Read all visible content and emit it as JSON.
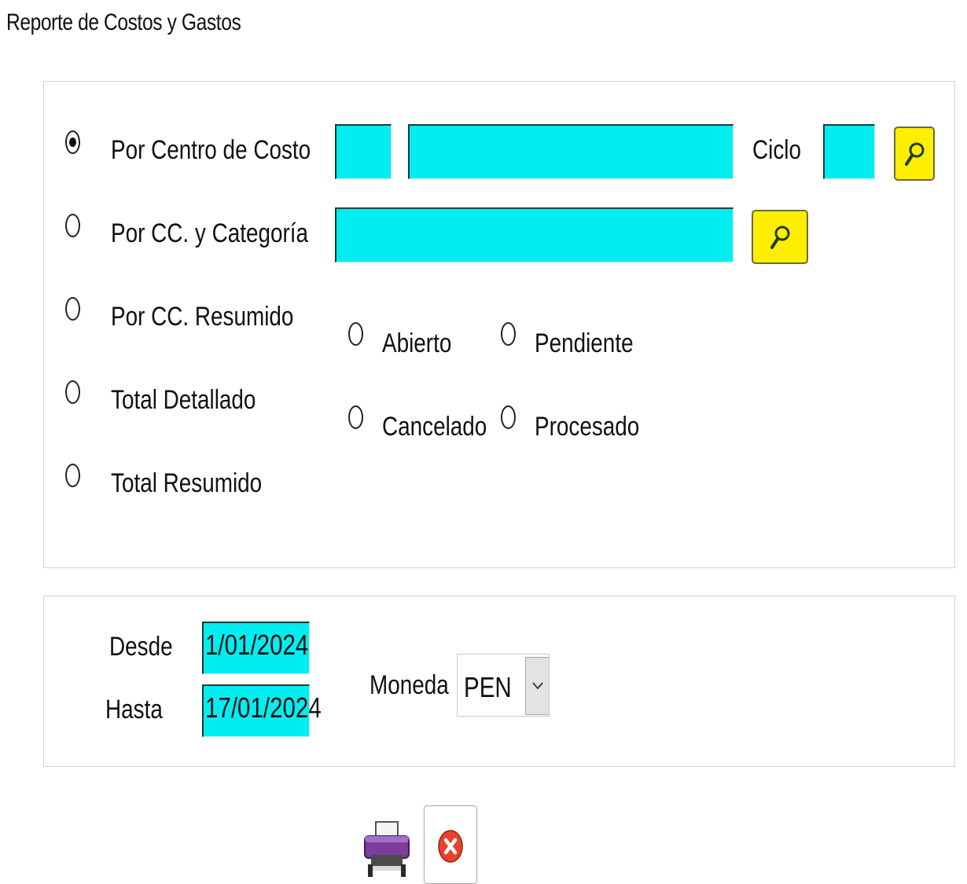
{
  "window": {
    "title": "Reporte de Costos y Gastos"
  },
  "report_type": {
    "options": [
      {
        "label": "Por Centro de Costo",
        "checked": true
      },
      {
        "label": "Por CC. y Categoría",
        "checked": false
      },
      {
        "label": "Por CC. Resumido",
        "checked": false
      },
      {
        "label": "Total Detallado",
        "checked": false
      },
      {
        "label": "Total Resumido",
        "checked": false
      }
    ]
  },
  "filters": {
    "cost_center_code": "",
    "cost_center_name": "",
    "ciclo_label": "Ciclo",
    "ciclo_value": "",
    "category": ""
  },
  "status": {
    "options": [
      {
        "label": "Abierto",
        "checked": false
      },
      {
        "label": "Pendiente",
        "checked": false
      },
      {
        "label": "Cancelado",
        "checked": false
      },
      {
        "label": "Procesado",
        "checked": false
      }
    ]
  },
  "dates": {
    "from_label": "Desde",
    "from_value": "1/01/2024",
    "to_label": "Hasta",
    "to_value": "17/01/2024"
  },
  "currency": {
    "label": "Moneda",
    "selected": "PEN"
  },
  "colors": {
    "input_bg": "#00eef0",
    "search_button_bg": "#ffee00",
    "close_icon": "#e8412d"
  },
  "icons": {
    "search": "search-icon",
    "print": "printer-icon",
    "close": "close-icon",
    "dropdown": "chevron-down-icon"
  }
}
